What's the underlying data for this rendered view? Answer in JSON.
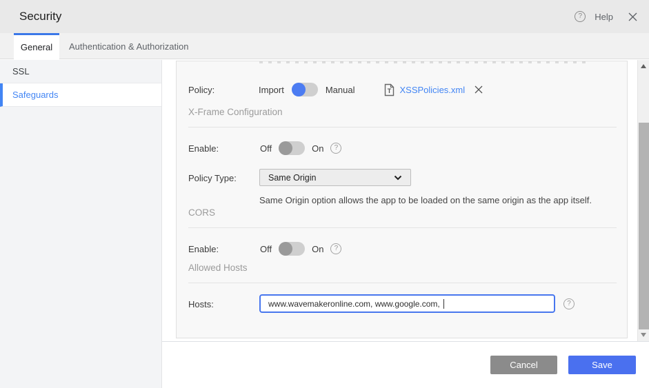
{
  "header": {
    "title": "Security",
    "help_label": "Help"
  },
  "tabs": [
    {
      "label": "General",
      "active": true
    },
    {
      "label": "Authentication & Authorization",
      "active": false
    }
  ],
  "sidebar": {
    "items": [
      {
        "label": "SSL",
        "active": false
      },
      {
        "label": "Safeguards",
        "active": true
      }
    ]
  },
  "content": {
    "policy": {
      "label": "Policy:",
      "option_left": "Import",
      "option_right": "Manual",
      "selected": "Import",
      "file_name": "XSSPolicies.xml"
    },
    "xframe": {
      "heading": "X-Frame Configuration",
      "enable_label": "Enable:",
      "off_label": "Off",
      "on_label": "On",
      "enabled": false,
      "policy_type_label": "Policy Type:",
      "policy_type_value": "Same Origin",
      "description": "Same Origin option allows the app to be loaded on the same origin as the app itself."
    },
    "cors": {
      "heading": "CORS",
      "enable_label": "Enable:",
      "off_label": "Off",
      "on_label": "On",
      "enabled": false
    },
    "allowed_hosts": {
      "heading": "Allowed Hosts",
      "hosts_label": "Hosts:",
      "hosts_value": "www.wavemakeronline.com, www.google.com, "
    }
  },
  "footer": {
    "cancel_label": "Cancel",
    "save_label": "Save"
  },
  "colors": {
    "accent": "#4285f4",
    "save_button": "#4a70ef",
    "cancel_button": "#8b8b8b",
    "toggle_on_knob": "#4c7cf2",
    "toggle_off_knob": "#9a9a9a",
    "link": "#4285f4"
  }
}
